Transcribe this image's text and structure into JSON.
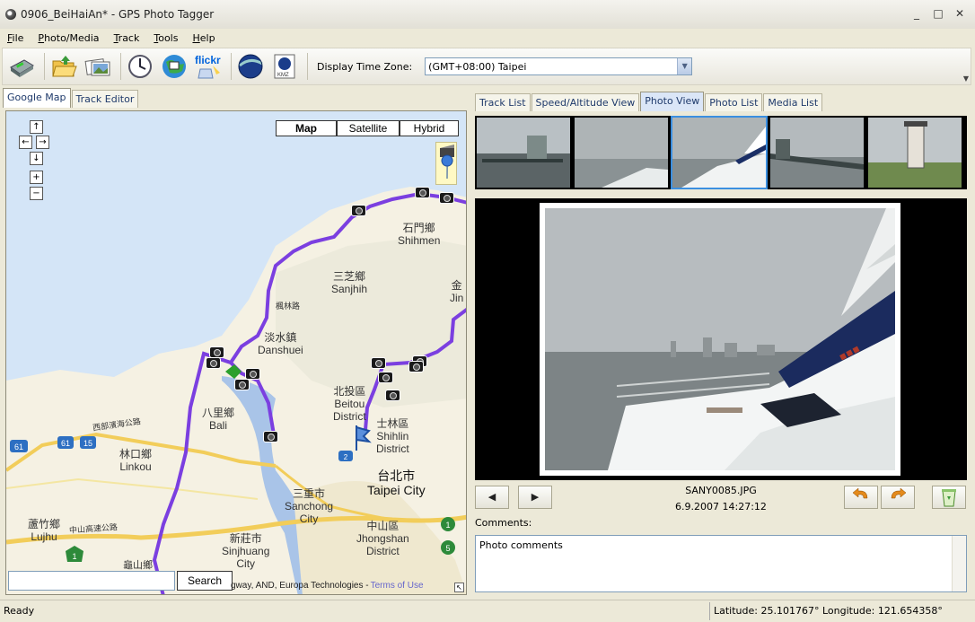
{
  "window": {
    "title": "0906_BeiHaiAn* - GPS Photo Tagger",
    "controls": [
      "_",
      "□",
      "✕"
    ]
  },
  "menu": [
    "File",
    "Photo/Media",
    "Track",
    "Tools",
    "Help"
  ],
  "toolbar": {
    "timezone_label": "Display Time Zone:",
    "timezone_value": "(GMT+08:00) Taipei",
    "flickr_label": "flickr",
    "kmz_label": "KMZ"
  },
  "left_tabs": [
    "Google Map",
    "Track Editor"
  ],
  "map": {
    "types": [
      "Map",
      "Satellite",
      "Hybrid"
    ],
    "nav": {
      "up": "↑",
      "left": "←",
      "right": "→",
      "down": "↓",
      "zoom_in": "+",
      "zoom_out": "−"
    },
    "search_button": "Search",
    "copyright": "gway, AND, Europa Technologies -",
    "terms": "Terms of Use",
    "labels": {
      "shihmen_cn": "石門鄉",
      "shihmen": "Shihmen",
      "sanjhih_cn": "三芝鄉",
      "sanjhih": "Sanjhih",
      "danshuei_cn": "淡水鎮",
      "danshuei": "Danshuei",
      "beitou_cn": "北投區",
      "beitou": "Beitou",
      "district1": "District",
      "shihlin_cn": "士林區",
      "shihlin": "Shihlin",
      "district2": "District",
      "bali_cn": "八里鄉",
      "bali": "Bali",
      "linkou_cn": "林口鄉",
      "linkou": "Linkou",
      "taipei_cn": "台北市",
      "taipei": "Taipei City",
      "sanchong_cn": "三重市",
      "sanchong": "Sanchong",
      "city1": "City",
      "sinjhuang_cn": "新莊市",
      "sinjhuang": "Sinjhuang",
      "city2": "City",
      "jhongshan_cn": "中山區",
      "jhongshan": "Jhongshan",
      "district3": "District",
      "lujhu_cn": "蘆竹鄉",
      "lujhu": "Lujhu",
      "jin_cn": "金",
      "jin": "Jin",
      "road1": "西部濱海公路",
      "road2": "楓林路",
      "road3": "中山高速公路",
      "road4": "龜山鄉",
      "shield_61": "61",
      "shield_61b": "61",
      "shield_15": "15",
      "shield_1": "1",
      "shield_1b": "1",
      "shield_5": "5",
      "shield_2": "2"
    }
  },
  "right_tabs": [
    "Track List",
    "Speed/Altitude View",
    "Photo View",
    "Photo List",
    "Media List"
  ],
  "active_right_tab": "Photo View",
  "photo": {
    "filename": "SANY0085.JPG",
    "datetime": "6.9.2007 14:27:12",
    "prev": "◀",
    "next": "▶",
    "comments_label": "Comments:",
    "comments_value": "Photo comments"
  },
  "status": {
    "left": "Ready",
    "coords": "Latitude: 25.101767°  Longitude: 121.654358°"
  },
  "colors": {
    "track": "#7b3fe0",
    "water": "#a9c4e8",
    "land": "#f5f1e3",
    "highway": "#f2cd5a"
  }
}
